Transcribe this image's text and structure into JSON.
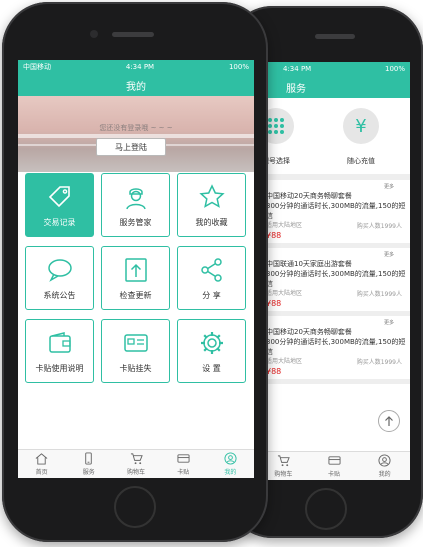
{
  "front": {
    "status": {
      "carrier": "中国移动 ",
      "time": "4:34 PM",
      "battery": "100%"
    },
    "title": "我的",
    "banner": {
      "hint": "您还没有登录哦 ~ ~ ~",
      "login": "马上登陆"
    },
    "tiles": [
      {
        "label": "交易记录",
        "icon": "tag-icon"
      },
      {
        "label": "服务管家",
        "icon": "agent-icon"
      },
      {
        "label": "我的收藏",
        "icon": "star-icon"
      },
      {
        "label": "系统公告",
        "icon": "speech-bubble-icon"
      },
      {
        "label": "检查更新",
        "icon": "upload-icon"
      },
      {
        "label": "分  享",
        "icon": "share-icon"
      },
      {
        "label": "卡贴使用说明",
        "icon": "wallet-icon"
      },
      {
        "label": "卡贴挂失",
        "icon": "id-card-icon"
      },
      {
        "label": "设  置",
        "icon": "gear-icon"
      }
    ],
    "tabs": [
      "首页",
      "服务",
      "购物车",
      "卡贴",
      "我的"
    ]
  },
  "back": {
    "status": {
      "time": "4:34 PM",
      "battery": "100%"
    },
    "title": "服务",
    "services": [
      "靓号选择",
      "随心充值"
    ],
    "more": "更多",
    "packages": [
      {
        "title": "中国移动20天商务畅聊套餐",
        "desc": "300分钟的通话时长,300MB的流量,150的短信",
        "area": "适用大陆地区",
        "sold": "购买人数1999人",
        "price": "¥88"
      },
      {
        "title": "中国联通10天家庭出游套餐",
        "desc": "300分钟的通话时长,300MB的流量,150的短信",
        "area": "适用大陆地区",
        "sold": "购买人数1999人",
        "price": "¥88"
      },
      {
        "title": "中国移动20天商务畅聊套餐",
        "desc": "300分钟的通话时长,300MB的流量,150的短信",
        "area": "适用大陆地区",
        "sold": "购买人数1999人",
        "price": "¥88"
      }
    ],
    "tabs": [
      "购物车",
      "卡贴",
      "我的"
    ]
  },
  "colors": {
    "accent": "#2fbfa3",
    "price": "#e02020"
  }
}
